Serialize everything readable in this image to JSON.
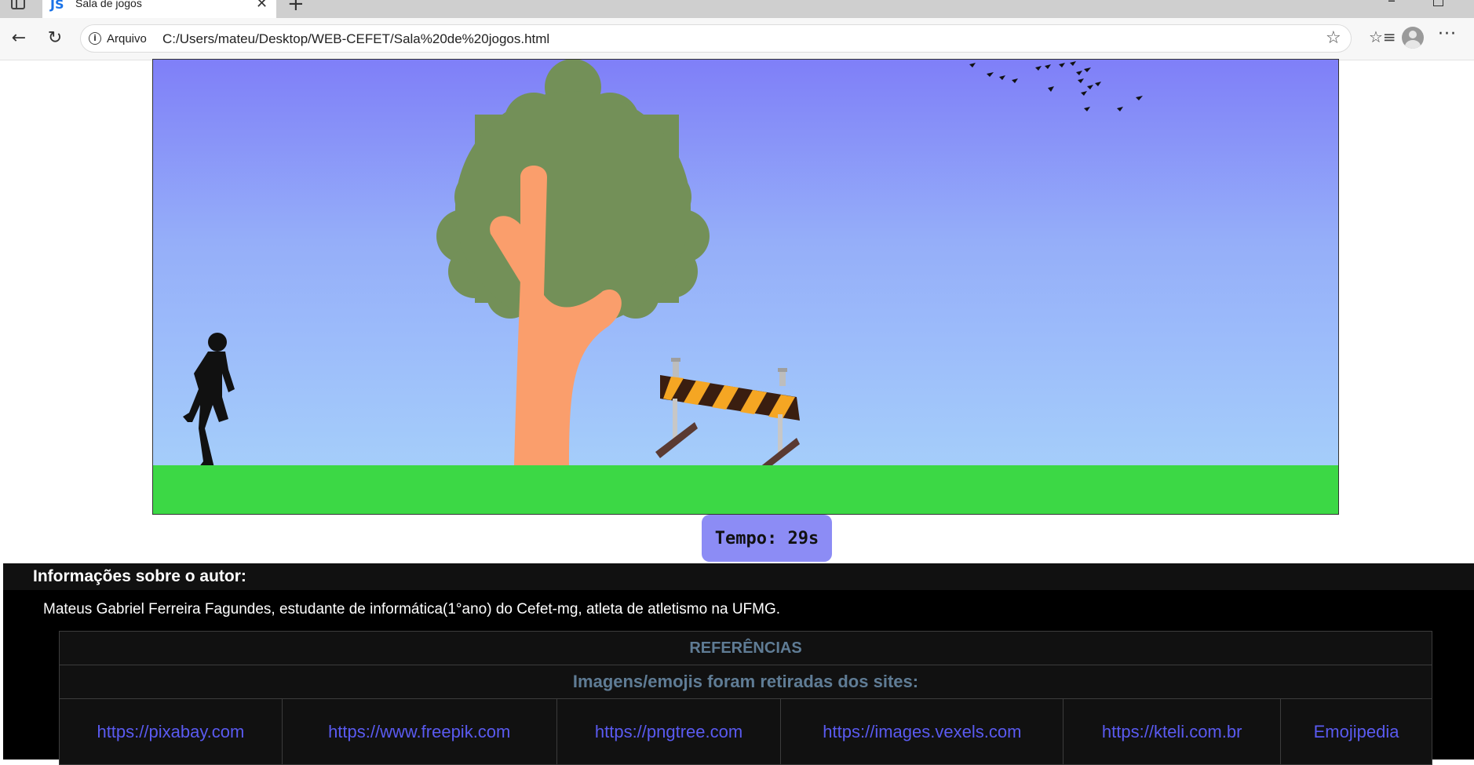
{
  "browser": {
    "tab_title": "Sala de jogos",
    "tab_favicon": "JS",
    "address_label": "Arquivo",
    "url": "C:/Users/mateu/Desktop/WEB-CEFET/Sala%20de%20jogos.html",
    "icons": [
      "sidebar-icon",
      "close-icon",
      "new-tab-icon",
      "back-icon",
      "reload-icon",
      "info-icon",
      "star-icon",
      "favorites-icon",
      "profile-avatar",
      "more-icon",
      "minimize-icon",
      "maximize-icon"
    ]
  },
  "game": {
    "scene_elements": [
      "runner-silhouette",
      "tree",
      "hurdle-barrier",
      "birds-flock",
      "grass"
    ],
    "colors": {
      "sky_top": "#7f7ff8",
      "sky_bottom": "#a8d4fb",
      "grass": "#3cd845",
      "tree_foliage": "#739058",
      "tree_trunk": "#fa9e6c"
    }
  },
  "timer": {
    "text": "Tempo: 29s",
    "color": "#8c8cf5"
  },
  "author": {
    "title": "Informações sobre o autor:",
    "text": "Mateus Gabriel Ferreira Fagundes, estudante de informática(1°ano) do Cefet-mg, atleta de atletismo na UFMG."
  },
  "references": {
    "heading": "REFERÊNCIAS",
    "subheading": "Imagens/emojis foram retiradas dos sites:",
    "links": [
      "https://pixabay.com",
      "https://www.freepik.com",
      "https://pngtree.com",
      "https://images.vexels.com",
      "https://kteli.com.br",
      "Emojipedia"
    ]
  }
}
